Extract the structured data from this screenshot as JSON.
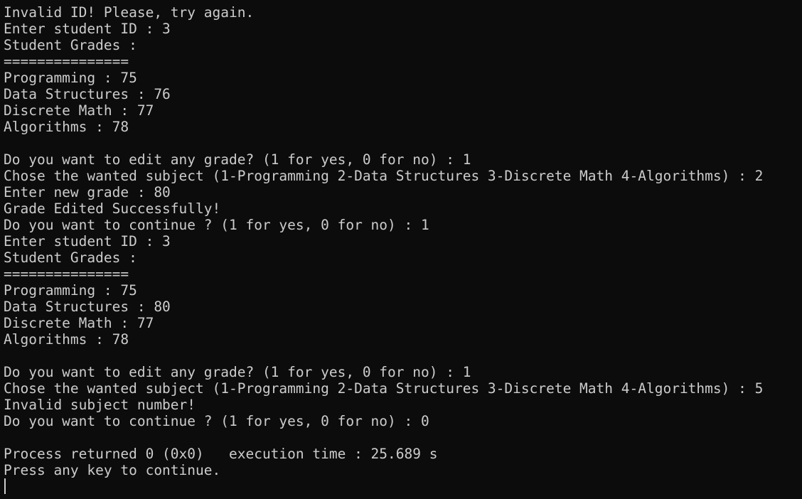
{
  "terminal": {
    "background": "#0c0c0c",
    "foreground": "#cccccc",
    "lines": [
      "Invalid ID! Please, try again.",
      "Enter student ID : 3",
      "Student Grades :",
      "===============",
      "Programming : 75",
      "Data Structures : 76",
      "Discrete Math : 77",
      "Algorithms : 78",
      "",
      "Do you want to edit any grade? (1 for yes, 0 for no) : 1",
      "Chose the wanted subject (1-Programming 2-Data Structures 3-Discrete Math 4-Algorithms) : 2",
      "Enter new grade : 80",
      "Grade Edited Successfully!",
      "Do you want to continue ? (1 for yes, 0 for no) : 1",
      "Enter student ID : 3",
      "Student Grades :",
      "===============",
      "Programming : 75",
      "Data Structures : 80",
      "Discrete Math : 77",
      "Algorithms : 78",
      "",
      "Do you want to edit any grade? (1 for yes, 0 for no) : 1",
      "Chose the wanted subject (1-Programming 2-Data Structures 3-Discrete Math 4-Algorithms) : 5",
      "Invalid subject number!",
      "Do you want to continue ? (1 for yes, 0 for no) : 0",
      "",
      "Process returned 0 (0x0)   execution time : 25.689 s",
      "Press any key to continue."
    ]
  }
}
